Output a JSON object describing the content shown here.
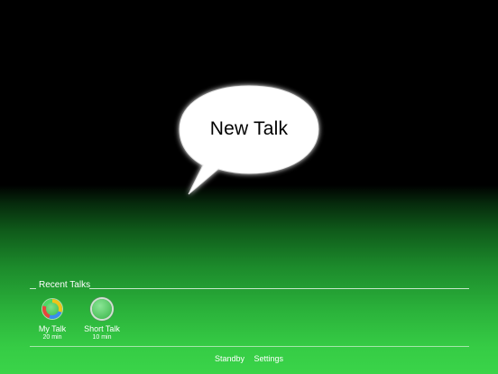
{
  "bubble": {
    "label": "New Talk"
  },
  "recent": {
    "title": "Recent Talks",
    "items": [
      {
        "name": "My Talk",
        "duration": "20 min",
        "icon": "multicolor-ring-icon"
      },
      {
        "name": "Short Talk",
        "duration": "10 min",
        "icon": "green-ring-icon"
      }
    ]
  },
  "footer": {
    "standby_label": "Standby",
    "settings_label": "Settings"
  },
  "colors": {
    "background_top": "#000000",
    "background_bottom": "#3ad449",
    "bubble_fill": "#ffffff",
    "text": "#ffffff"
  }
}
